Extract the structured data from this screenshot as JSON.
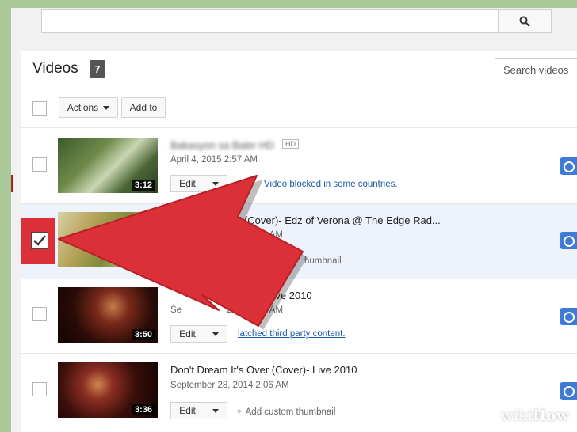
{
  "header": {
    "search_placeholder": "",
    "search_icon": "search-icon"
  },
  "videos_panel": {
    "title": "Videos",
    "count": "7",
    "search_placeholder": "Search videos"
  },
  "toolbar": {
    "actions_label": "Actions",
    "add_to_label": "Add to"
  },
  "videos": [
    {
      "title": "Bakasyon sa Baler HD",
      "hd": "HD",
      "date": "April 4, 2015 2:57 AM",
      "duration": "3:12",
      "edit_label": "Edit",
      "status": "Video blocked in some countries.",
      "checked": false
    },
    {
      "title": "ns\" (Cover)- Edz of Verona @ The Edge Rad...",
      "date": "2014 2:38 AM",
      "duration": "",
      "edit_label": "Edit",
      "status": "humbnail",
      "checked": true
    },
    {
      "title": "(Cover) -Live 2010",
      "date_prefix": "Se",
      "date": "2014 2:15 AM",
      "duration": "3:50",
      "edit_label": "Edit",
      "status": "latched third party content.",
      "checked": false
    },
    {
      "title": "Don't Dream It's Over (Cover)- Live 2010",
      "date": "September 28, 2014 2:06 AM",
      "duration": "3:36",
      "edit_label": "Edit",
      "status": "Add custom thumbnail",
      "checked": false
    }
  ],
  "overlay": {
    "arrow_color": "#dc3038",
    "highlight_color": "#dc3038"
  },
  "watermark": {
    "prefix": "wiki",
    "suffix": "How"
  }
}
